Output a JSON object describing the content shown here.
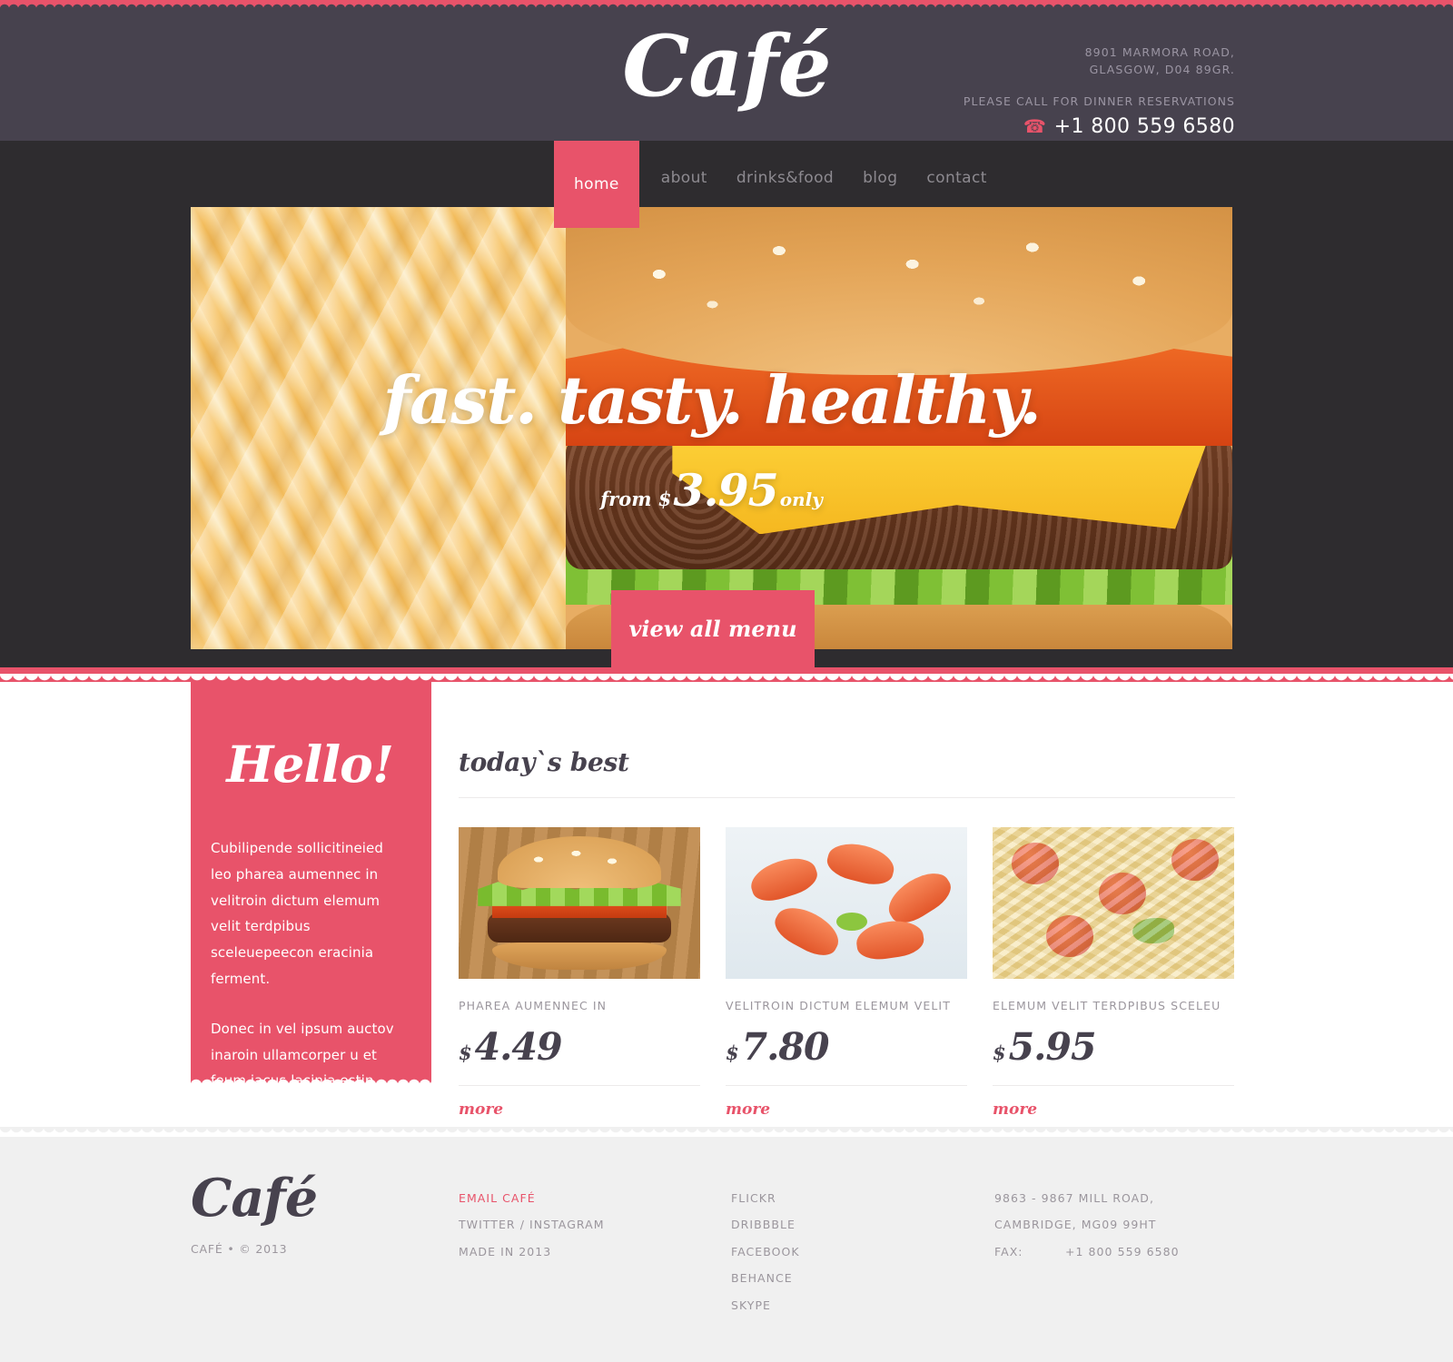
{
  "colors": {
    "accent": "#e8536a",
    "header_bg": "#47424e",
    "dark_bg": "#2e2c2f",
    "footer_bg": "#f0f0f0",
    "muted_text": "#9b969d"
  },
  "header": {
    "logo": "Café",
    "address_line1": "8901 MARMORA ROAD,",
    "address_line2": "GLASGOW, D04 89GR.",
    "reservation_note": "PLEASE CALL FOR DINNER RESERVATIONS",
    "phone": "+1 800 559 6580",
    "phone_icon": "phone-icon"
  },
  "nav": {
    "items": [
      {
        "label": "home",
        "active": true
      },
      {
        "label": "about",
        "active": false
      },
      {
        "label": "drinks&food",
        "active": false
      },
      {
        "label": "blog",
        "active": false
      },
      {
        "label": "contact",
        "active": false
      }
    ]
  },
  "hero": {
    "headline": "fast. tasty. healthy.",
    "price_prefix": "from $",
    "price_amount": "3.95",
    "price_suffix": "only",
    "cta_label": "view all menu"
  },
  "hello": {
    "title": "Hello!",
    "paragraph1": "Cubilipende sollicitineied leo pharea aumennec in velitroin dictum elemum velit terdpibus sceleuepeecon eracinia ferment.",
    "paragraph2": "Donec in vel ipsum auctov inaroin ullamcorper u et feum iacus lacinia estin dictum elemenelit. Fusce euismod conseq."
  },
  "todays_best": {
    "title": "today`s best",
    "currency": "$",
    "more_label": "more",
    "cards": [
      {
        "name": "PHAREA AUMENNEC IN",
        "price": "4.49",
        "image": "burger-photo"
      },
      {
        "name": "VELITROIN DICTUM ELEMUM VELIT",
        "price": "7.80",
        "image": "shrimp-photo"
      },
      {
        "name": "ELEMUM VELIT TERDPIBUS SCELEU",
        "price": "5.95",
        "image": "pasta-photo"
      }
    ]
  },
  "footer": {
    "logo": "Café",
    "copyright": "CAFÉ • © 2013",
    "links": [
      {
        "label": "EMAIL CAFÉ",
        "accent": true
      },
      {
        "label": "TWITTER / INSTAGRAM",
        "accent": false
      },
      {
        "label": "MADE IN 2013",
        "accent": false
      }
    ],
    "social": [
      {
        "label": "FLICKR"
      },
      {
        "label": "DRIBBBLE"
      },
      {
        "label": "FACEBOOK"
      },
      {
        "label": "BEHANCE"
      },
      {
        "label": "SKYPE"
      }
    ],
    "address_line1": "9863 - 9867 MILL ROAD,",
    "address_line2": "CAMBRIDGE, MG09 99HT",
    "fax_label": "FAX:",
    "fax_value": "+1 800 559 6580"
  }
}
